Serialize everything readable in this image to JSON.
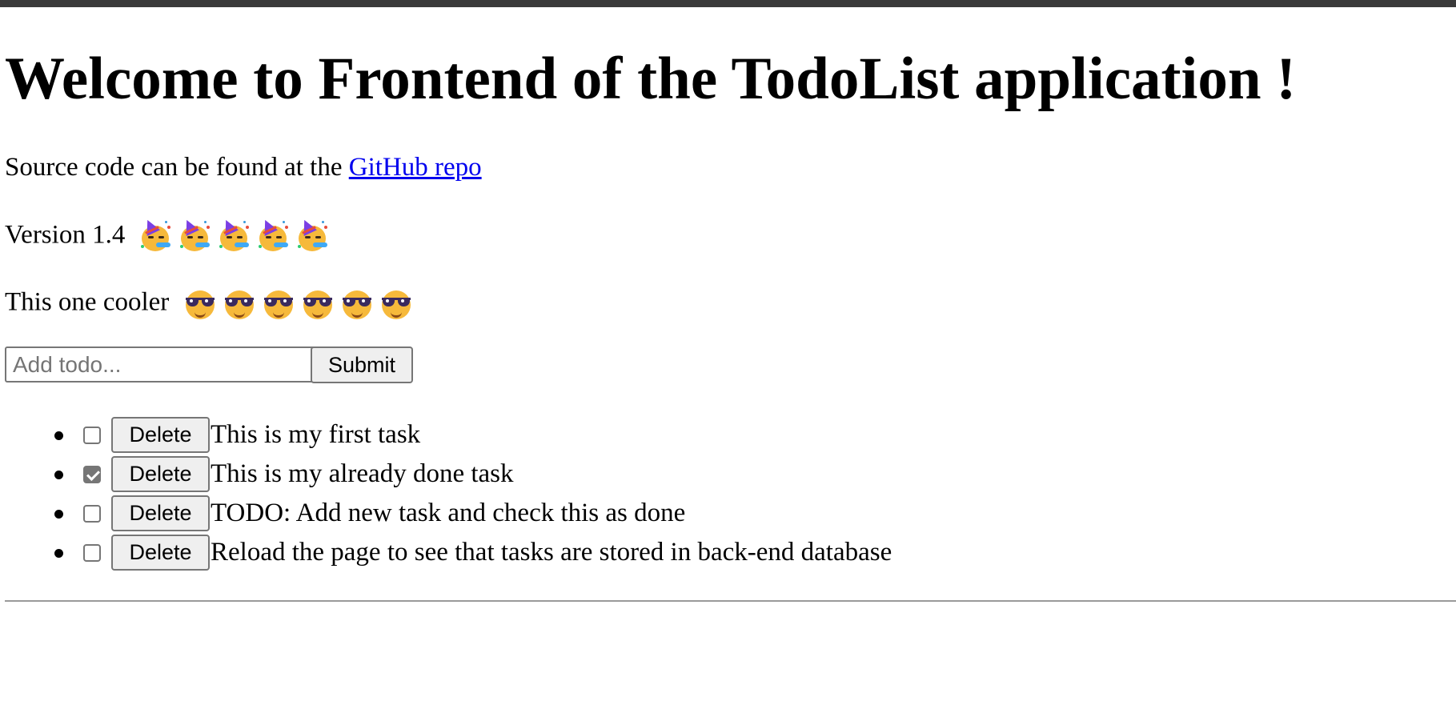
{
  "header": {
    "title": "Welcome to Frontend of the TodoList application !"
  },
  "source": {
    "prefix": "Source code can be found at the ",
    "link_text": "GitHub repo"
  },
  "version": {
    "label": "Version 1.4",
    "emoji_icon": "partying-face-emoji",
    "emoji_count": 5
  },
  "cooler": {
    "label": "This one cooler",
    "emoji_icon": "smiling-face-with-sunglasses-emoji",
    "emoji_count": 6
  },
  "form": {
    "placeholder": "Add todo...",
    "value": "",
    "submit_label": "Submit"
  },
  "todos": [
    {
      "done": false,
      "delete_label": "Delete",
      "text": "This is my first task"
    },
    {
      "done": true,
      "delete_label": "Delete",
      "text": "This is my already done task"
    },
    {
      "done": false,
      "delete_label": "Delete",
      "text": "TODO: Add new task and check this as done"
    },
    {
      "done": false,
      "delete_label": "Delete",
      "text": "Reload the page to see that tasks are stored in back-end database"
    }
  ],
  "colors": {
    "link": "#0000ee",
    "topbar": "#3a3a3a",
    "button_bg": "#efefef",
    "emoji_face": "#f6b93b"
  }
}
